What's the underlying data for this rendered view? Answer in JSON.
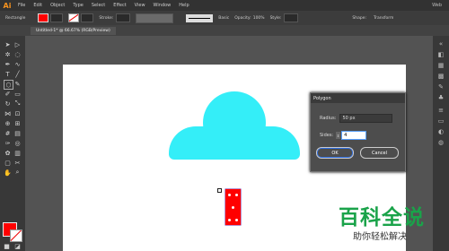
{
  "app": {
    "logo": "Ai",
    "menus": [
      "File",
      "Edit",
      "Object",
      "Type",
      "Select",
      "Effect",
      "View",
      "Window",
      "Help"
    ],
    "workspace": "Web"
  },
  "control_bar": {
    "tool_name": "Rectangle",
    "stroke_label": "Stroke:",
    "stroke_style": "Basic",
    "opacity_label": "Opacity:",
    "opacity_value": "100%",
    "style_label": "Style:",
    "shape_label": "Shape:",
    "transform_label": "Transform"
  },
  "document": {
    "tab_title": "Untitled-1* @ 66.67% (RGB/Preview)"
  },
  "colors": {
    "fill": "#ff0000",
    "cloud": "#34eef8",
    "canvas_bg": "#535353",
    "artboard": "#ffffff"
  },
  "polygon_dialog": {
    "title": "Polygon",
    "radius_label": "Radius:",
    "radius_value": "50 px",
    "sides_label": "Sides:",
    "sides_value": "4",
    "ok_label": "OK",
    "cancel_label": "Cancel"
  },
  "watermark": {
    "main": "百科全说",
    "sub": "助你轻松解决"
  }
}
